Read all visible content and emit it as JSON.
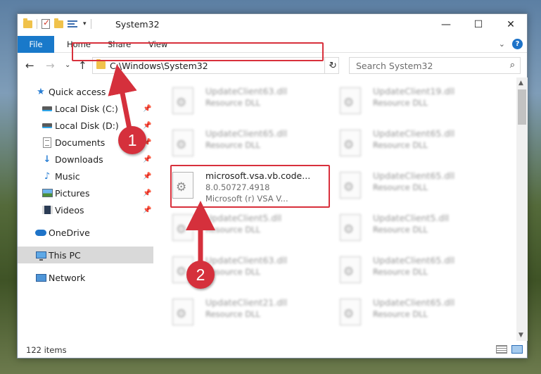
{
  "window": {
    "title": "System32",
    "controls": {
      "minimize": "—",
      "maximize": "☐",
      "close": "✕"
    }
  },
  "ribbon": {
    "file_tab": "File",
    "tabs": [
      "Home",
      "Share",
      "View"
    ],
    "help": "?"
  },
  "nav": {
    "address": "C:\\Windows\\System32",
    "search_placeholder": "Search System32"
  },
  "sidebar": {
    "quick_access": "Quick access",
    "items": [
      {
        "label": "Local Disk (C:)",
        "icon": "drive-icon"
      },
      {
        "label": "Local Disk (D:)",
        "icon": "drive-icon"
      },
      {
        "label": "Documents",
        "icon": "documents-icon"
      },
      {
        "label": "Downloads",
        "icon": "downloads-icon"
      },
      {
        "label": "Music",
        "icon": "music-icon"
      },
      {
        "label": "Pictures",
        "icon": "pictures-icon"
      },
      {
        "label": "Videos",
        "icon": "videos-icon"
      }
    ],
    "onedrive": "OneDrive",
    "this_pc": "This PC",
    "network": "Network"
  },
  "files": {
    "highlighted": {
      "name": "microsoft.vsa.vb.code...",
      "version": "8.0.50727.4918",
      "description": "Microsoft (r) VSA V..."
    },
    "left_column": [
      {
        "name": "UpdateClient63.dll",
        "type": "Resource DLL"
      },
      {
        "name": "UpdateClient65.dll",
        "type": "Resource DLL"
      },
      {
        "name": "UpdateClient5.dll",
        "type": "Resource DLL"
      },
      {
        "name": "UpdateClient63.dll",
        "type": "Resource DLL"
      },
      {
        "name": "UpdateClient21.dll",
        "type": "Resource DLL"
      }
    ],
    "right_column": [
      {
        "name": "UpdateClient19.dll",
        "type": "Resource DLL"
      },
      {
        "name": "UpdateClient65.dll",
        "type": "Resource DLL"
      },
      {
        "name": "UpdateClient65.dll",
        "type": "Resource DLL"
      },
      {
        "name": "UpdateClient5.dll",
        "type": "Resource DLL"
      },
      {
        "name": "UpdateClient65.dll",
        "type": "Resource DLL"
      },
      {
        "name": "UpdateClient65.dll",
        "type": "Resource DLL"
      }
    ]
  },
  "status": {
    "item_count": "122 items"
  },
  "callouts": {
    "one": "1",
    "two": "2"
  },
  "colors": {
    "accent": "#1979ca",
    "highlight": "#d8303c",
    "selected": "#d9d9d9"
  }
}
